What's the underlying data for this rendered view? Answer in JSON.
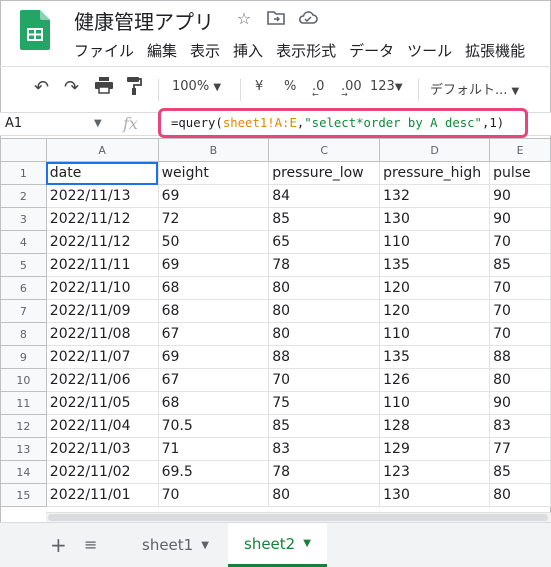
{
  "app": {
    "title": "健康管理アプリ",
    "menu": [
      "ファイル",
      "編集",
      "表示",
      "挿入",
      "表示形式",
      "データ",
      "ツール",
      "拡張機能"
    ]
  },
  "toolbar": {
    "zoom": "100%",
    "currency": "¥",
    "percent": "%",
    "dec_decrease": ".0",
    "dec_increase": ".00",
    "number_format": "123",
    "font": "デフォルト..."
  },
  "formula_bar": {
    "cell_ref": "A1",
    "fx": "fx",
    "formula_parts": [
      {
        "text": "=query(",
        "kind": "fn"
      },
      {
        "text": "sheet1!A:E",
        "kind": "range"
      },
      {
        "text": ",",
        "kind": "fn"
      },
      {
        "text": "\"select*order by A desc\"",
        "kind": "str"
      },
      {
        "text": ",1)",
        "kind": "fn"
      }
    ]
  },
  "grid": {
    "columns": [
      "A",
      "B",
      "C",
      "D",
      "E"
    ],
    "rows": [
      [
        "date",
        "weight",
        "pressure_low",
        "pressure_high",
        "pulse"
      ],
      [
        "2022/11/13",
        "69",
        "84",
        "132",
        "90"
      ],
      [
        "2022/11/12",
        "72",
        "85",
        "130",
        "90"
      ],
      [
        "2022/11/12",
        "50",
        "65",
        "110",
        "70"
      ],
      [
        "2022/11/11",
        "69",
        "78",
        "135",
        "85"
      ],
      [
        "2022/11/10",
        "68",
        "80",
        "120",
        "70"
      ],
      [
        "2022/11/09",
        "68",
        "80",
        "120",
        "70"
      ],
      [
        "2022/11/08",
        "67",
        "80",
        "110",
        "70"
      ],
      [
        "2022/11/07",
        "69",
        "88",
        "135",
        "88"
      ],
      [
        "2022/11/06",
        "67",
        "70",
        "126",
        "80"
      ],
      [
        "2022/11/05",
        "68",
        "75",
        "110",
        "90"
      ],
      [
        "2022/11/04",
        "70.5",
        "85",
        "128",
        "83"
      ],
      [
        "2022/11/03",
        "71",
        "83",
        "129",
        "77"
      ],
      [
        "2022/11/02",
        "69.5",
        "78",
        "123",
        "85"
      ],
      [
        "2022/11/01",
        "70",
        "80",
        "130",
        "80"
      ]
    ]
  },
  "sheets": {
    "add_icon": "+",
    "list_icon": "≡",
    "tabs": [
      {
        "label": "sheet1",
        "active": false
      },
      {
        "label": "sheet2",
        "active": true
      }
    ]
  },
  "colors": {
    "sheets_green": "#188038",
    "formula_highlight": "#e8457a",
    "range_orange": "#e08a00",
    "string_green": "#0f8a3c"
  }
}
